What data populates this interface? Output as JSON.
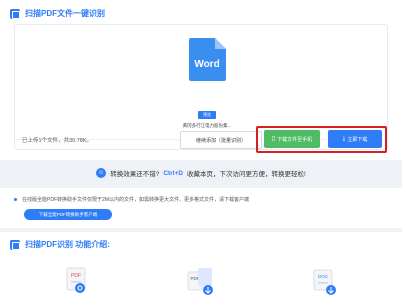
{
  "header": {
    "title": "扫描PDF文件一键识别"
  },
  "file": {
    "badge": "预览",
    "name": "黄冈多行江电力股份集..."
  },
  "footer": {
    "stats": "已上传1个文件，共30.78K。",
    "add_button": "继续添加（批量识别）",
    "phone_button": "下载文件至手机",
    "download_button": "立即下载"
  },
  "tip": {
    "prefix": "转换效果还不错?",
    "key": "Ctrl+D",
    "suffix": "收藏本页，下次访问更方便，转换更轻松!"
  },
  "notice": {
    "text": "在线版全能PDF转换助手文件仅限于2M以内的文件，如需转换更大文件、更多格式文件，请下载客户端",
    "client_button": "下载全能PDF转换助手客户端"
  },
  "features": {
    "title": "扫描PDF识别 功能介绍:",
    "labels": [
      "PDF",
      "PDF",
      "DOC"
    ]
  },
  "colors": {
    "accent": "#2f7df6",
    "green": "#4fbb63",
    "highlight": "#d42020"
  }
}
